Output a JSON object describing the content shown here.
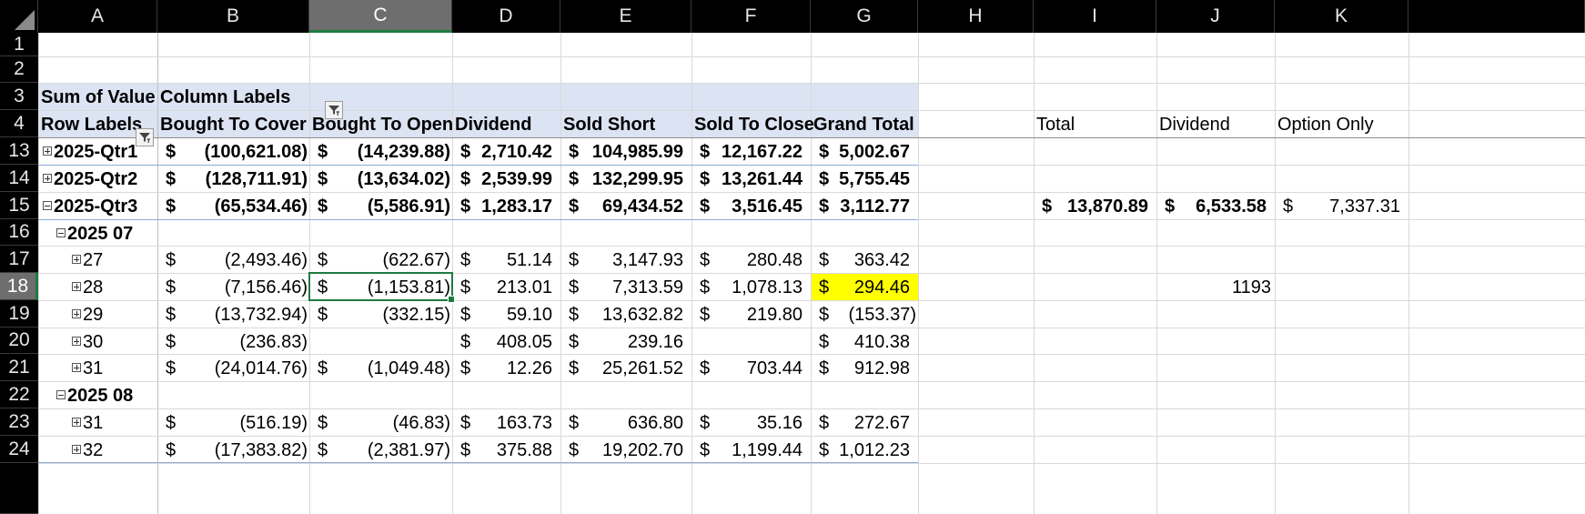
{
  "sheet": {
    "corner_icon": "select-all-triangle",
    "selected_cell": "C18",
    "columns": [
      "A",
      "B",
      "C",
      "D",
      "E",
      "F",
      "G",
      "H",
      "I",
      "J",
      "K"
    ],
    "rows": [
      "1",
      "2",
      "3",
      "4",
      "13",
      "14",
      "15",
      "16",
      "17",
      "18",
      "19",
      "20",
      "21",
      "22",
      "23",
      "24"
    ],
    "colors": {
      "header_bg": "#000000",
      "selected_header_bg": "#6e6e6e",
      "pivot_band": "#dce3f2",
      "highlight": "#ffff00",
      "selection_border": "#1e7b3f"
    }
  },
  "pivot": {
    "value_label": "Sum of Value",
    "column_labels": "Column Labels",
    "row_labels": "Row Labels",
    "headers": [
      "Bought To Cover",
      "Bought To Open",
      "Dividend",
      "Sold Short",
      "Sold To Close",
      "Grand Total"
    ],
    "dollar": "$",
    "rows": [
      {
        "label": "2025-Qtr1",
        "toggle": "plus",
        "level": 0,
        "bold": true,
        "cells": [
          "(100,621.08)",
          "(14,239.88)",
          "2,710.42",
          "104,985.99",
          "12,167.22",
          "5,002.67"
        ]
      },
      {
        "label": "2025-Qtr2",
        "toggle": "plus",
        "level": 0,
        "bold": true,
        "cells": [
          "(128,711.91)",
          "(13,634.02)",
          "2,539.99",
          "132,299.95",
          "13,261.44",
          "5,755.45"
        ]
      },
      {
        "label": "2025-Qtr3",
        "toggle": "minus",
        "level": 0,
        "bold": true,
        "cells": [
          "(65,534.46)",
          "(5,586.91)",
          "1,283.17",
          "69,434.52",
          "3,516.45",
          "3,112.77"
        ]
      },
      {
        "label": "2025 07",
        "toggle": "minus",
        "level": 1,
        "bold": true,
        "cells": [
          "",
          "",
          "",
          "",
          "",
          ""
        ]
      },
      {
        "label": "27",
        "toggle": "plus",
        "level": 2,
        "bold": false,
        "cells": [
          "(2,493.46)",
          "(622.67)",
          "51.14",
          "3,147.93",
          "280.48",
          "363.42"
        ]
      },
      {
        "label": "28",
        "toggle": "plus",
        "level": 2,
        "bold": false,
        "cells": [
          "(7,156.46)",
          "(1,153.81)",
          "213.01",
          "7,313.59",
          "1,078.13",
          "294.46"
        ]
      },
      {
        "label": "29",
        "toggle": "plus",
        "level": 2,
        "bold": false,
        "cells": [
          "(13,732.94)",
          "(332.15)",
          "59.10",
          "13,632.82",
          "219.80",
          "(153.37)"
        ]
      },
      {
        "label": "30",
        "toggle": "plus",
        "level": 2,
        "bold": false,
        "cells": [
          "(236.83)",
          "",
          "408.05",
          "239.16",
          "",
          "410.38"
        ]
      },
      {
        "label": "31",
        "toggle": "plus",
        "level": 2,
        "bold": false,
        "cells": [
          "(24,014.76)",
          "(1,049.48)",
          "12.26",
          "25,261.52",
          "703.44",
          "912.98"
        ]
      },
      {
        "label": "2025 08",
        "toggle": "minus",
        "level": 1,
        "bold": true,
        "cells": [
          "",
          "",
          "",
          "",
          "",
          ""
        ]
      },
      {
        "label": "31",
        "toggle": "plus",
        "level": 2,
        "bold": false,
        "cells": [
          "(516.19)",
          "(46.83)",
          "163.73",
          "636.80",
          "35.16",
          "272.67"
        ]
      },
      {
        "label": "32",
        "toggle": "plus",
        "level": 2,
        "bold": false,
        "cells": [
          "(17,383.82)",
          "(2,381.97)",
          "375.88",
          "19,202.70",
          "1,199.44",
          "1,012.23"
        ]
      }
    ]
  },
  "side": {
    "headers": [
      "Total",
      "Dividend",
      "Option Only"
    ],
    "row15": [
      "13,870.89",
      "6,533.58",
      "7,337.31"
    ],
    "j18": "1193"
  }
}
